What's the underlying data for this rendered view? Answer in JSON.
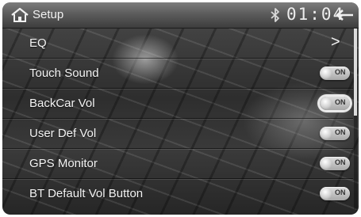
{
  "header": {
    "title": "Setup",
    "time": "01:04",
    "home_icon": "home-icon",
    "bluetooth_icon": "bluetooth-icon",
    "back_icon": "back-arrow-icon"
  },
  "settings": [
    {
      "label": "EQ",
      "control": "chevron",
      "chevron_text": ">"
    },
    {
      "label": "Touch Sound",
      "control": "toggle",
      "state": "ON"
    },
    {
      "label": "BackCar Vol",
      "control": "toggle",
      "state": "ON",
      "focused": true
    },
    {
      "label": "User Def Vol",
      "control": "toggle",
      "state": "ON"
    },
    {
      "label": "GPS Monitor",
      "control": "toggle",
      "state": "ON"
    },
    {
      "label": "BT Default Vol Button",
      "control": "toggle",
      "state": "ON"
    }
  ],
  "colors": {
    "text": "#f4f4f4",
    "topbar": "#5c5c5c",
    "background": "#333333"
  }
}
